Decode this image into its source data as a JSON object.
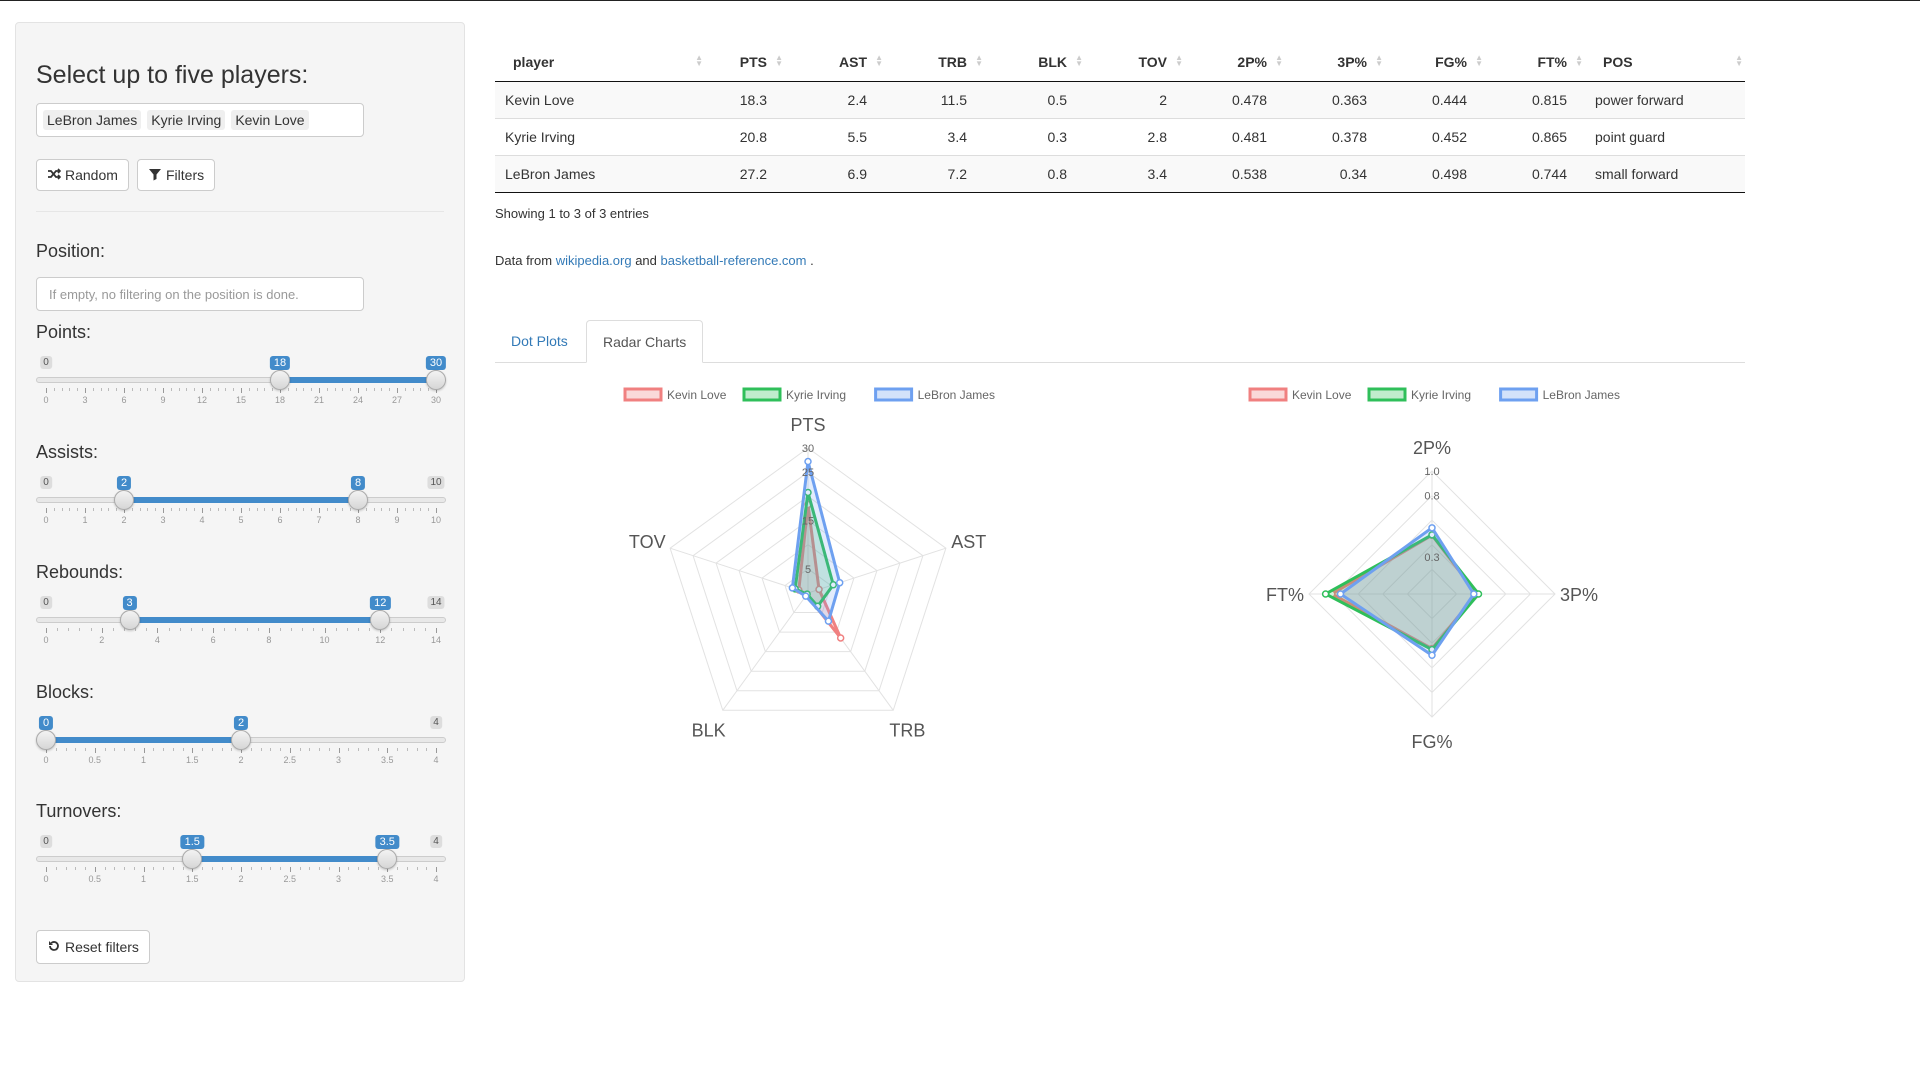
{
  "sidebar": {
    "title": "Select up to five players:",
    "selected_players": [
      "LeBron James",
      "Kyrie Irving",
      "Kevin Love"
    ],
    "random_label": "Random",
    "filters_label": "Filters",
    "position_label": "Position:",
    "position_placeholder": "If empty, no filtering on the position is done.",
    "reset_label": "Reset filters",
    "sliders": [
      {
        "label": "Points:",
        "min": 0,
        "max": 30,
        "from": 18,
        "to": 30,
        "ticks": [
          0,
          3,
          6,
          9,
          12,
          15,
          18,
          21,
          24,
          27,
          30
        ]
      },
      {
        "label": "Assists:",
        "min": 0,
        "max": 10,
        "from": 2,
        "to": 8,
        "ticks": [
          0,
          1,
          2,
          3,
          4,
          5,
          6,
          7,
          8,
          9,
          10
        ]
      },
      {
        "label": "Rebounds:",
        "min": 0,
        "max": 14,
        "from": 3,
        "to": 12,
        "ticks": [
          0,
          2,
          4,
          6,
          8,
          10,
          12,
          14
        ]
      },
      {
        "label": "Blocks:",
        "min": 0,
        "max": 4,
        "from": 0,
        "to": 2,
        "ticks": [
          0,
          0.5,
          1,
          1.5,
          2,
          2.5,
          3,
          3.5,
          4
        ]
      },
      {
        "label": "Turnovers:",
        "min": 0,
        "max": 4,
        "from": 1.5,
        "to": 3.5,
        "ticks": [
          0,
          0.5,
          1,
          1.5,
          2,
          2.5,
          3,
          3.5,
          4
        ]
      }
    ]
  },
  "table": {
    "columns": [
      "player",
      "PTS",
      "AST",
      "TRB",
      "BLK",
      "TOV",
      "2P%",
      "3P%",
      "FG%",
      "FT%",
      "POS"
    ],
    "rows": [
      [
        "Kevin Love",
        "18.3",
        "2.4",
        "11.5",
        "0.5",
        "2",
        "0.478",
        "0.363",
        "0.444",
        "0.815",
        "power forward"
      ],
      [
        "Kyrie Irving",
        "20.8",
        "5.5",
        "3.4",
        "0.3",
        "2.8",
        "0.481",
        "0.378",
        "0.452",
        "0.865",
        "point guard"
      ],
      [
        "LeBron James",
        "27.2",
        "6.9",
        "7.2",
        "0.8",
        "3.4",
        "0.538",
        "0.34",
        "0.498",
        "0.744",
        "small forward"
      ]
    ],
    "info": "Showing 1 to 3 of 3 entries"
  },
  "credits": {
    "prefix": "Data from",
    "link1": "wikipedia.org",
    "middle": "and",
    "link2": "basketball-reference.com",
    "suffix": "."
  },
  "tabs": [
    "Dot Plots",
    "Radar Charts"
  ],
  "active_tab": "Radar Charts",
  "colors": {
    "Kevin Love": "#f08080",
    "Kyrie Irving": "#2fbf5a",
    "LeBron James": "#6ea0f0",
    "accent": "#428bca",
    "link": "#337ab7"
  },
  "chart_data": [
    {
      "type": "radar",
      "axes": [
        "PTS",
        "AST",
        "TRB",
        "BLK",
        "TOV"
      ],
      "rlim": [
        0,
        30
      ],
      "r_ticks": [
        "5",
        "15",
        "25",
        "30"
      ],
      "legend_position": "top",
      "series": [
        {
          "name": "Kevin Love",
          "values": [
            18.3,
            2.4,
            11.5,
            0.5,
            2
          ]
        },
        {
          "name": "Kyrie Irving",
          "values": [
            20.8,
            5.5,
            3.4,
            0.3,
            2.8
          ]
        },
        {
          "name": "LeBron James",
          "values": [
            27.2,
            6.9,
            7.2,
            0.8,
            3.4
          ]
        }
      ]
    },
    {
      "type": "radar",
      "axes": [
        "2P%",
        "3P%",
        "FG%",
        "FT%"
      ],
      "rlim": [
        0,
        1.0
      ],
      "r_ticks": [
        "0.3",
        "0.8",
        "1.0"
      ],
      "legend_position": "top",
      "series": [
        {
          "name": "Kevin Love",
          "values": [
            0.478,
            0.363,
            0.444,
            0.815
          ]
        },
        {
          "name": "Kyrie Irving",
          "values": [
            0.481,
            0.378,
            0.452,
            0.865
          ]
        },
        {
          "name": "LeBron James",
          "values": [
            0.538,
            0.34,
            0.498,
            0.744
          ]
        }
      ]
    }
  ]
}
